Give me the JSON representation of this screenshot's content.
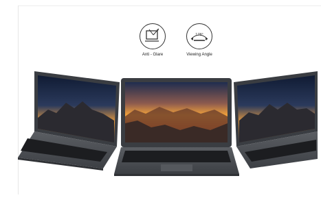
{
  "features": [
    {
      "icon": "anti-glare-icon",
      "label": "Anti - Glare"
    },
    {
      "icon": "viewing-angle-icon",
      "label": "Viewing Angle",
      "icon_text": "178°"
    }
  ],
  "laptops": [
    {
      "name": "left-laptop",
      "screen": "mountain-dusk-wallpaper"
    },
    {
      "name": "center-laptop",
      "screen": "sunset-valley-wallpaper"
    },
    {
      "name": "right-laptop",
      "screen": "mountain-dusk-wallpaper"
    }
  ],
  "colors": {
    "chassis": "#4a4d52",
    "keyboard": "#1c1d20",
    "sky_top": "#16233e",
    "sky_glow": "#f2a03c",
    "mountain": "#2b2a30"
  }
}
